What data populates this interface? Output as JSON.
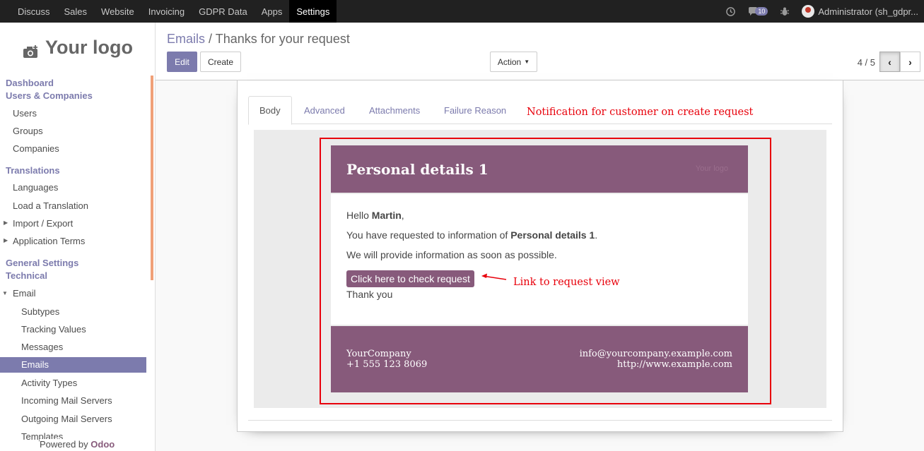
{
  "topbar": {
    "menu": [
      "Discuss",
      "Sales",
      "Website",
      "Invoicing",
      "GDPR Data",
      "Apps",
      "Settings"
    ],
    "active": "Settings",
    "chat_count": "10",
    "user": "Administrator (sh_gdpr..."
  },
  "sidebar": {
    "logo_text": "Your logo",
    "dashboard": "Dashboard",
    "users_companies": "Users & Companies",
    "users": "Users",
    "groups": "Groups",
    "companies": "Companies",
    "translations": "Translations",
    "languages": "Languages",
    "load_translation": "Load a Translation",
    "import_export": "Import / Export",
    "application_terms": "Application Terms",
    "general_settings": "General Settings",
    "technical": "Technical",
    "email": "Email",
    "subtypes": "Subtypes",
    "tracking_values": "Tracking Values",
    "messages": "Messages",
    "emails": "Emails",
    "activity_types": "Activity Types",
    "incoming_servers": "Incoming Mail Servers",
    "outgoing_servers": "Outgoing Mail Servers",
    "templates": "Templates",
    "powered_prefix": "Powered by",
    "powered_brand": "Odoo"
  },
  "control": {
    "breadcrumb_parent": "Emails",
    "breadcrumb_sep": "/",
    "breadcrumb_current": "Thanks for your request",
    "edit": "Edit",
    "create": "Create",
    "action": "Action",
    "pager": "4 / 5"
  },
  "tabs": [
    "Body",
    "Advanced",
    "Attachments",
    "Failure Reason"
  ],
  "annotations": {
    "top": "Notification for customer on create request",
    "link": "Link to request view"
  },
  "email": {
    "title": "Personal details 1",
    "ghost_logo": "Your logo",
    "hello_prefix": "Hello",
    "name": "Martin",
    "line1_prefix": "You have requested to information of",
    "line1_bold": "Personal details 1",
    "line2": "We will provide information as soon as possible.",
    "button": "Click here to check request",
    "thanks": "Thank you",
    "company": "YourCompany",
    "phone": "+1 555 123 8069",
    "email": "info@yourcompany.example.com",
    "website": "http://www.example.com"
  },
  "colors": {
    "brand": "#7c7bad",
    "mail": "#875a7b",
    "annotation": "#e8000b",
    "accent": "#f0a078"
  }
}
